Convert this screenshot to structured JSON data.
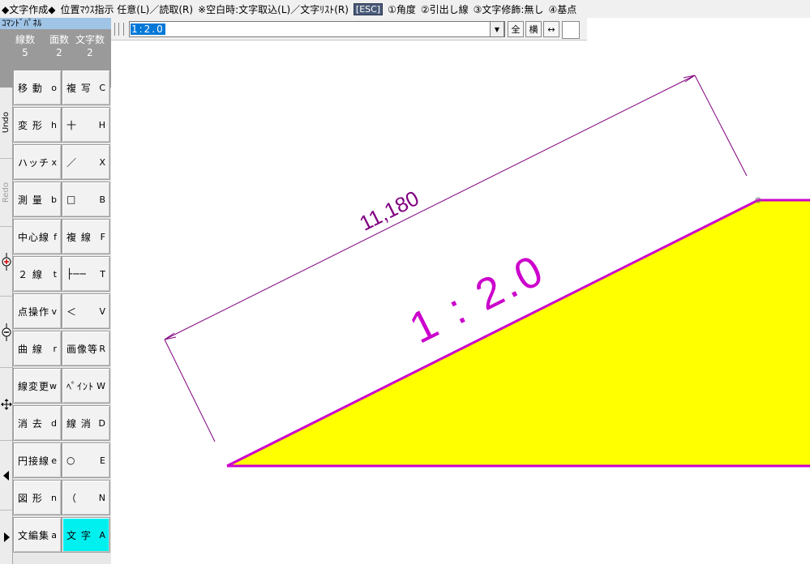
{
  "status": {
    "mode": "◆文字作成◆",
    "hint1": "位置ﾏｳｽ指示 任意(L)／読取(R)",
    "hint2": "※空白時:文字取込(L)／文字ﾘｽﾄ(R)",
    "esc": "[ESC]",
    "opt1": "①角度",
    "opt2": "②引出し線",
    "opt3": "③文字修飾:無し",
    "opt4": "④基点"
  },
  "panel": {
    "title": "ｺﾏﾝﾄﾞﾊﾟﾈﾙ",
    "stats": [
      {
        "label": "線数",
        "value": "5"
      },
      {
        "label": "面数",
        "value": "2"
      },
      {
        "label": "文字数",
        "value": "2"
      }
    ],
    "strip": {
      "undo": "Undo",
      "redo": "Redo"
    },
    "buttons": [
      {
        "label": "移 動",
        "key": "o"
      },
      {
        "label": "複 写",
        "key": "C"
      },
      {
        "label": "変 形",
        "key": "h"
      },
      {
        "label": "十",
        "key": "H"
      },
      {
        "label": "ハッチ",
        "key": "x"
      },
      {
        "label": "／",
        "key": "X"
      },
      {
        "label": "測 量",
        "key": "b"
      },
      {
        "label": "□",
        "key": "B"
      },
      {
        "label": "中心線",
        "key": "f"
      },
      {
        "label": "複 線",
        "key": "F"
      },
      {
        "label": "２ 線",
        "key": "t"
      },
      {
        "label": "├──",
        "key": "T"
      },
      {
        "label": "点操作",
        "key": "v"
      },
      {
        "label": "＜",
        "key": "V"
      },
      {
        "label": "曲 線",
        "key": "r"
      },
      {
        "label": "画像等",
        "key": "R"
      },
      {
        "label": "線変更",
        "key": "w"
      },
      {
        "label": "ﾍﾟｲﾝﾄ",
        "key": "W"
      },
      {
        "label": "消 去",
        "key": "d"
      },
      {
        "label": "線 消",
        "key": "D"
      },
      {
        "label": "円接線",
        "key": "e"
      },
      {
        "label": "○",
        "key": "E"
      },
      {
        "label": "図 形",
        "key": "n"
      },
      {
        "label": "（",
        "key": "N"
      },
      {
        "label": "文編集",
        "key": "a"
      },
      {
        "label": "文 字",
        "key": "A"
      }
    ]
  },
  "toolbar": {
    "input_value": "1:2.0",
    "btn_all": "全",
    "btn_horizontal": "横",
    "btn_spacing": "↔"
  },
  "drawing": {
    "dimension_text": "11,180",
    "slope_text": "1 : 2.0",
    "colors": {
      "fill": "#ffff00",
      "line": "#cc00cc",
      "dimension": "#800080"
    }
  }
}
